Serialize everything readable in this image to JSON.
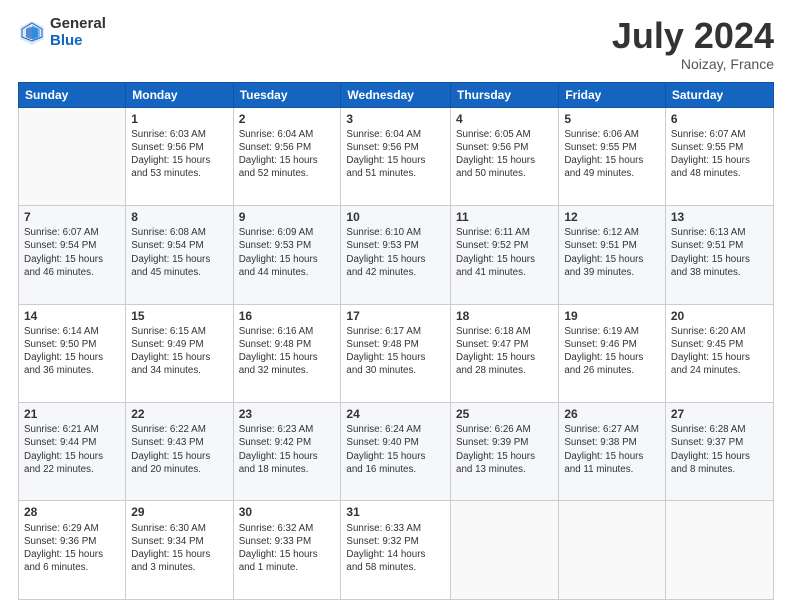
{
  "header": {
    "logo_general": "General",
    "logo_blue": "Blue",
    "main_title": "July 2024",
    "subtitle": "Noizay, France"
  },
  "days_of_week": [
    "Sunday",
    "Monday",
    "Tuesday",
    "Wednesday",
    "Thursday",
    "Friday",
    "Saturday"
  ],
  "weeks": [
    [
      {
        "day": "",
        "info": ""
      },
      {
        "day": "1",
        "info": "Sunrise: 6:03 AM\nSunset: 9:56 PM\nDaylight: 15 hours\nand 53 minutes."
      },
      {
        "day": "2",
        "info": "Sunrise: 6:04 AM\nSunset: 9:56 PM\nDaylight: 15 hours\nand 52 minutes."
      },
      {
        "day": "3",
        "info": "Sunrise: 6:04 AM\nSunset: 9:56 PM\nDaylight: 15 hours\nand 51 minutes."
      },
      {
        "day": "4",
        "info": "Sunrise: 6:05 AM\nSunset: 9:56 PM\nDaylight: 15 hours\nand 50 minutes."
      },
      {
        "day": "5",
        "info": "Sunrise: 6:06 AM\nSunset: 9:55 PM\nDaylight: 15 hours\nand 49 minutes."
      },
      {
        "day": "6",
        "info": "Sunrise: 6:07 AM\nSunset: 9:55 PM\nDaylight: 15 hours\nand 48 minutes."
      }
    ],
    [
      {
        "day": "7",
        "info": "Sunrise: 6:07 AM\nSunset: 9:54 PM\nDaylight: 15 hours\nand 46 minutes."
      },
      {
        "day": "8",
        "info": "Sunrise: 6:08 AM\nSunset: 9:54 PM\nDaylight: 15 hours\nand 45 minutes."
      },
      {
        "day": "9",
        "info": "Sunrise: 6:09 AM\nSunset: 9:53 PM\nDaylight: 15 hours\nand 44 minutes."
      },
      {
        "day": "10",
        "info": "Sunrise: 6:10 AM\nSunset: 9:53 PM\nDaylight: 15 hours\nand 42 minutes."
      },
      {
        "day": "11",
        "info": "Sunrise: 6:11 AM\nSunset: 9:52 PM\nDaylight: 15 hours\nand 41 minutes."
      },
      {
        "day": "12",
        "info": "Sunrise: 6:12 AM\nSunset: 9:51 PM\nDaylight: 15 hours\nand 39 minutes."
      },
      {
        "day": "13",
        "info": "Sunrise: 6:13 AM\nSunset: 9:51 PM\nDaylight: 15 hours\nand 38 minutes."
      }
    ],
    [
      {
        "day": "14",
        "info": "Sunrise: 6:14 AM\nSunset: 9:50 PM\nDaylight: 15 hours\nand 36 minutes."
      },
      {
        "day": "15",
        "info": "Sunrise: 6:15 AM\nSunset: 9:49 PM\nDaylight: 15 hours\nand 34 minutes."
      },
      {
        "day": "16",
        "info": "Sunrise: 6:16 AM\nSunset: 9:48 PM\nDaylight: 15 hours\nand 32 minutes."
      },
      {
        "day": "17",
        "info": "Sunrise: 6:17 AM\nSunset: 9:48 PM\nDaylight: 15 hours\nand 30 minutes."
      },
      {
        "day": "18",
        "info": "Sunrise: 6:18 AM\nSunset: 9:47 PM\nDaylight: 15 hours\nand 28 minutes."
      },
      {
        "day": "19",
        "info": "Sunrise: 6:19 AM\nSunset: 9:46 PM\nDaylight: 15 hours\nand 26 minutes."
      },
      {
        "day": "20",
        "info": "Sunrise: 6:20 AM\nSunset: 9:45 PM\nDaylight: 15 hours\nand 24 minutes."
      }
    ],
    [
      {
        "day": "21",
        "info": "Sunrise: 6:21 AM\nSunset: 9:44 PM\nDaylight: 15 hours\nand 22 minutes."
      },
      {
        "day": "22",
        "info": "Sunrise: 6:22 AM\nSunset: 9:43 PM\nDaylight: 15 hours\nand 20 minutes."
      },
      {
        "day": "23",
        "info": "Sunrise: 6:23 AM\nSunset: 9:42 PM\nDaylight: 15 hours\nand 18 minutes."
      },
      {
        "day": "24",
        "info": "Sunrise: 6:24 AM\nSunset: 9:40 PM\nDaylight: 15 hours\nand 16 minutes."
      },
      {
        "day": "25",
        "info": "Sunrise: 6:26 AM\nSunset: 9:39 PM\nDaylight: 15 hours\nand 13 minutes."
      },
      {
        "day": "26",
        "info": "Sunrise: 6:27 AM\nSunset: 9:38 PM\nDaylight: 15 hours\nand 11 minutes."
      },
      {
        "day": "27",
        "info": "Sunrise: 6:28 AM\nSunset: 9:37 PM\nDaylight: 15 hours\nand 8 minutes."
      }
    ],
    [
      {
        "day": "28",
        "info": "Sunrise: 6:29 AM\nSunset: 9:36 PM\nDaylight: 15 hours\nand 6 minutes."
      },
      {
        "day": "29",
        "info": "Sunrise: 6:30 AM\nSunset: 9:34 PM\nDaylight: 15 hours\nand 3 minutes."
      },
      {
        "day": "30",
        "info": "Sunrise: 6:32 AM\nSunset: 9:33 PM\nDaylight: 15 hours\nand 1 minute."
      },
      {
        "day": "31",
        "info": "Sunrise: 6:33 AM\nSunset: 9:32 PM\nDaylight: 14 hours\nand 58 minutes."
      },
      {
        "day": "",
        "info": ""
      },
      {
        "day": "",
        "info": ""
      },
      {
        "day": "",
        "info": ""
      }
    ]
  ]
}
